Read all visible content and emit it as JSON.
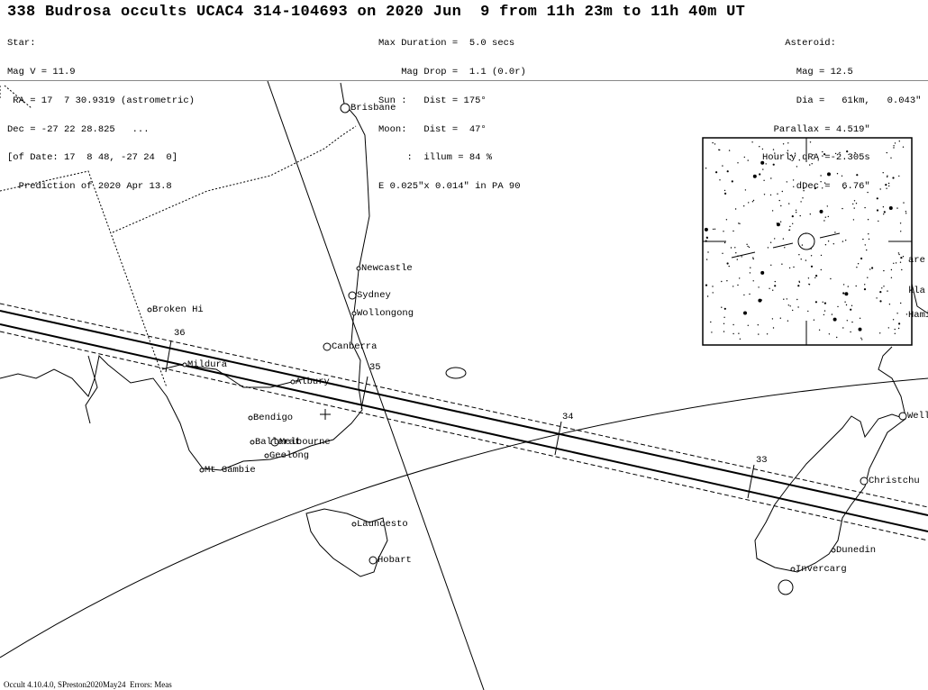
{
  "header": {
    "title": "338 Budrosa occults UCAC4 314-104693 on 2020 Jun  9 from 11h 23m to 11h 40m UT",
    "star": [
      "Star:",
      "Mag V = 11.9",
      " RA = 17  7 30.9319 (astrometric)",
      "Dec = -27 22 28.825   ...",
      "[of Date: 17  8 48, -27 24  0]",
      "  Prediction of 2020 Apr 13.8"
    ],
    "event": [
      "Max Duration =  5.0 secs",
      "    Mag Drop =  1.1 (0.0r)",
      "Sun :   Dist = 175°",
      "Moon:   Dist =  47°",
      "     :  illum = 84 %",
      "E 0.025\"x 0.014\" in PA 90"
    ],
    "asteroid": [
      "    Asteroid:",
      "      Mag = 12.5",
      "      Dia =   61km,   0.043\"",
      "  Parallax = 4.519\"",
      "Hourly dRA =-2.305s",
      "      dDec =  6.76\""
    ]
  },
  "map": {
    "cities": [
      "Brisbane",
      "Newcastle",
      "Sydney",
      "Wollongong",
      "Broken Hi",
      "Canberra",
      "Mildura",
      "Albury",
      "Bendigo",
      "Ballarat",
      "Melbourne",
      "Geelong",
      "Mt Gambie",
      "Launcesto",
      "Hobart",
      "Christchu",
      "Dunedin",
      "Invercarg",
      "Well",
      "are",
      "kla",
      "Hami"
    ],
    "time_ticks": [
      "36",
      "35",
      "34",
      "33"
    ],
    "colors": {
      "lines": "#000000",
      "background": "#ffffff"
    }
  },
  "footer": "Occult 4.10.4.0, SPreston2020May24  Errors: Meas"
}
